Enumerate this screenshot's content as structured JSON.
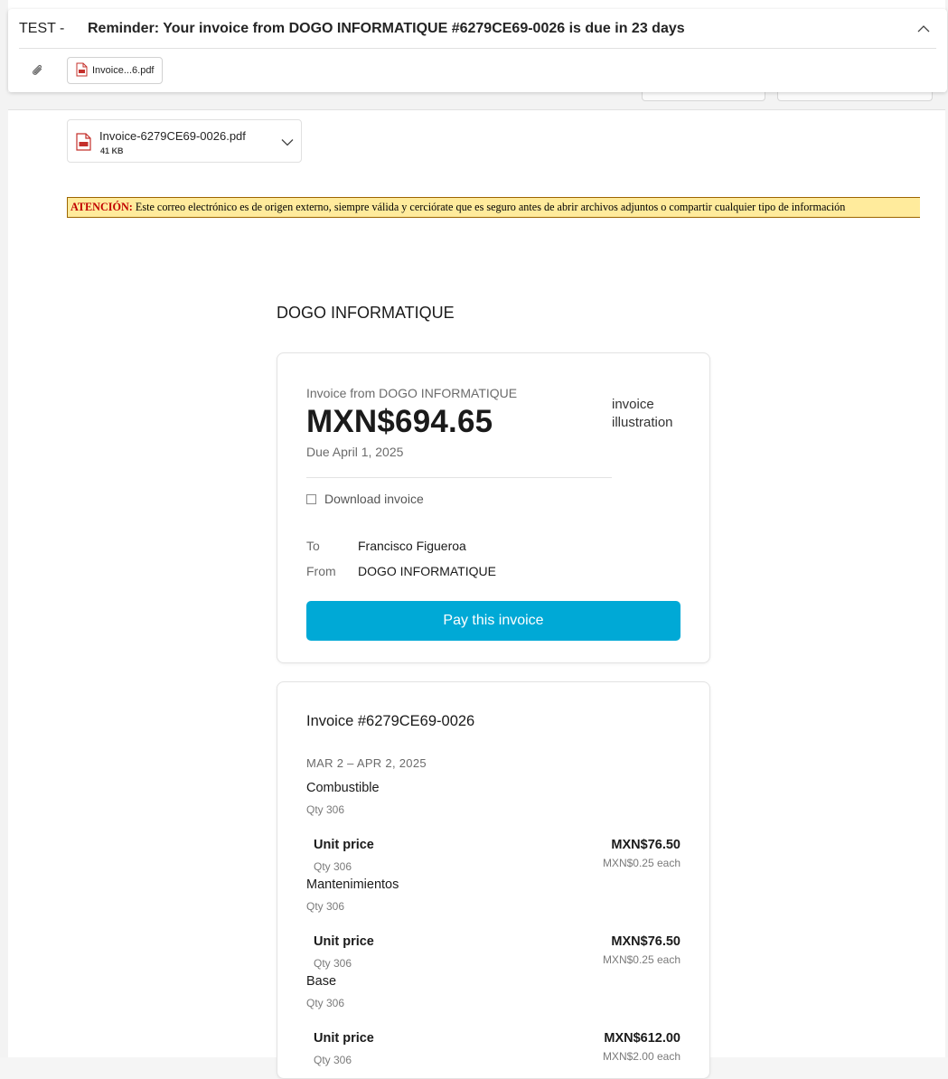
{
  "header": {
    "tag": "TEST -",
    "subject": "Reminder: Your invoice from DOGO INFORMATIQUE #6279CE69-0026 is due in 23 days",
    "attachment_chip": "Invoice...6.pdf"
  },
  "attachment": {
    "filename": "Invoice-6279CE69-0026.pdf",
    "size": "41 KB"
  },
  "warning": {
    "label": "ATENCIÓN:",
    "text": " Este correo electrónico es de origen externo, siempre válida y cerciórate que es seguro antes de abrir archivos adjuntos o compartir cualquier tipo de información"
  },
  "invoice": {
    "merchant": "DOGO INFORMATIQUE",
    "from_line": "Invoice from DOGO INFORMATIQUE",
    "amount": "MXN$694.65",
    "due": "Due April 1, 2025",
    "illustration_alt": "invoice illustration",
    "download_label": "Download invoice",
    "to_label": "To",
    "to_value": "Francisco Figueroa",
    "from_label": "From",
    "from_value": "DOGO INFORMATIQUE",
    "pay_button": "Pay this invoice"
  },
  "details": {
    "number": "Invoice #6279CE69-0026",
    "period": "MAR 2 – APR 2, 2025",
    "items": [
      {
        "name": "Combustible",
        "qty": "Qty 306",
        "unit_label": "Unit price",
        "unit_qty": "Qty 306",
        "amount": "MXN$76.50",
        "each": "MXN$0.25 each"
      },
      {
        "name": "Mantenimientos",
        "qty": "Qty 306",
        "unit_label": "Unit price",
        "unit_qty": "Qty 306",
        "amount": "MXN$76.50",
        "each": "MXN$0.25 each"
      },
      {
        "name": "Base",
        "qty": "Qty 306",
        "unit_label": "Unit price",
        "unit_qty": "Qty 306",
        "amount": "MXN$612.00",
        "each": "MXN$2.00 each"
      }
    ]
  },
  "colors": {
    "pay_button": "#00a9d6",
    "warning_bg": "#ffeb9c",
    "warning_label": "#c00000"
  }
}
